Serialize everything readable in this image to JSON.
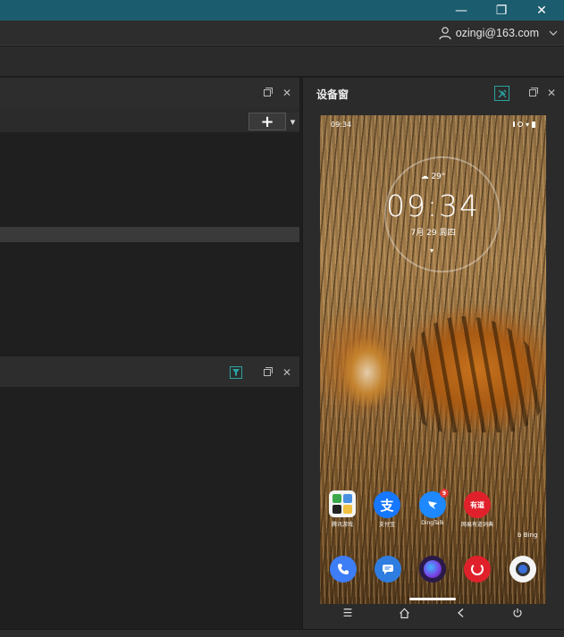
{
  "window": {
    "minimize": "—",
    "restore": "❐",
    "close": "✕"
  },
  "account": {
    "email": "ozingi@163.com"
  },
  "top_panel": {
    "add_label": "+",
    "dropdown": "▾"
  },
  "device_window": {
    "title": "设备窗"
  },
  "phone": {
    "status_time": "09:34",
    "lock_time": "09:34",
    "weather": "29°",
    "date": "7月 29 周四",
    "bing": "Bing",
    "apps_row1": [
      {
        "label": "腾讯游戏",
        "color": "#f4f4f4"
      },
      {
        "label": "支付宝",
        "color": "#1677ff"
      },
      {
        "label": "DingTalk",
        "color": "#1e88ff",
        "badge": "9"
      },
      {
        "label": "网易有道词典",
        "color": "#e0212b"
      }
    ],
    "apps_row2": [
      {
        "label": "phone",
        "color": "#3d7df5"
      },
      {
        "label": "messages",
        "color": "#2f7de1"
      },
      {
        "label": "browser",
        "color": "#4a2a7a"
      },
      {
        "label": "music",
        "color": "#e0212b"
      },
      {
        "label": "camera",
        "color": "#f4f4f4"
      }
    ],
    "youdao_glyph": "有道"
  }
}
